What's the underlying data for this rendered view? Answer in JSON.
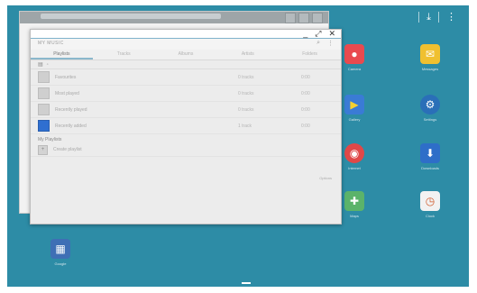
{
  "status_bar": {
    "download_icon": "download-icon",
    "menu_icon": "more-vert-icon"
  },
  "background_window": {},
  "front_window": {
    "controls": {
      "minimize": "_",
      "maximize": "⤢",
      "close": "✕"
    },
    "app_title": "MY MUSIC",
    "tabs": [
      {
        "label": "Playlists",
        "active": true
      },
      {
        "label": "Tracks",
        "active": false
      },
      {
        "label": "Albums",
        "active": false
      },
      {
        "label": "Artists",
        "active": false
      },
      {
        "label": "Folders",
        "active": false
      }
    ],
    "playlists": [
      {
        "name": "Favourites",
        "count": "0 tracks",
        "size": "0:00"
      },
      {
        "name": "Most played",
        "count": "0 tracks",
        "size": "0:00"
      },
      {
        "name": "Recently played",
        "count": "0 tracks",
        "size": "0:00"
      },
      {
        "name": "Recently added",
        "count": "1 track",
        "size": "0:00"
      }
    ],
    "section_title": "My Playlists",
    "create_label": "Create playlist",
    "footer_label": "Options"
  },
  "desktop_apps": [
    {
      "label": "Camera",
      "color": "#e94a4f",
      "glyph": "●"
    },
    {
      "label": "Messages",
      "color": "#f0c030",
      "glyph": "✉"
    },
    {
      "label": "Gallery",
      "color": "#3a7bd5",
      "glyph": "▶"
    },
    {
      "label": "Settings",
      "color": "#2a6fb8",
      "glyph": "⚙"
    },
    {
      "label": "Internet",
      "color": "#e04848",
      "glyph": "◉"
    },
    {
      "label": "Downloads",
      "color": "#2e6ec8",
      "glyph": "⬇"
    },
    {
      "label": "Maps",
      "color": "#5bb36a",
      "glyph": "✚"
    },
    {
      "label": "Clock",
      "color": "#f2f2f2",
      "glyph": "◷"
    },
    {
      "label": "Google",
      "color": "#3f6fb5",
      "glyph": "▦"
    }
  ],
  "nav": {
    "home_label": "home"
  }
}
